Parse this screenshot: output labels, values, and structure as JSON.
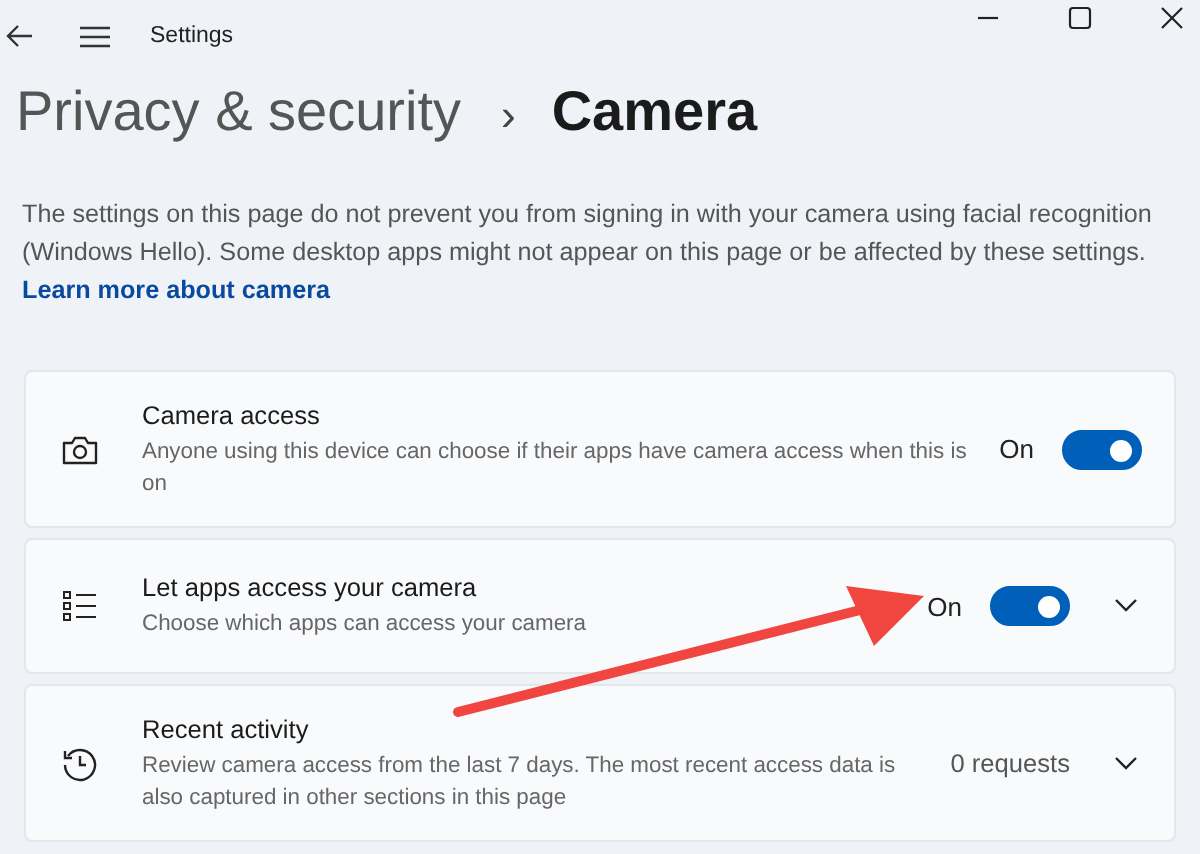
{
  "window": {
    "title": "Settings"
  },
  "breadcrumb": {
    "parent": "Privacy & security",
    "separator": "›",
    "current": "Camera"
  },
  "description": {
    "text": "The settings on this page do not prevent you from signing in with your camera using facial recognition (Windows Hello). Some desktop apps might not appear on this page or be affected by these settings.",
    "link": "Learn more about camera"
  },
  "settings": [
    {
      "kind": "toggle",
      "title": "Camera access",
      "subtitle": "Anyone using this device can choose if their apps have camera access when this is on",
      "state_label": "On",
      "on": true
    },
    {
      "kind": "toggle_expand",
      "title": "Let apps access your camera",
      "subtitle": "Choose which apps can access your camera",
      "state_label": "On",
      "on": true,
      "expanded": false
    },
    {
      "kind": "value_expand",
      "title": "Recent activity",
      "subtitle": "Review camera access from the last 7 days. The most recent access data is also captured in other sections in this page",
      "value": "0 requests",
      "expanded": false
    }
  ]
}
